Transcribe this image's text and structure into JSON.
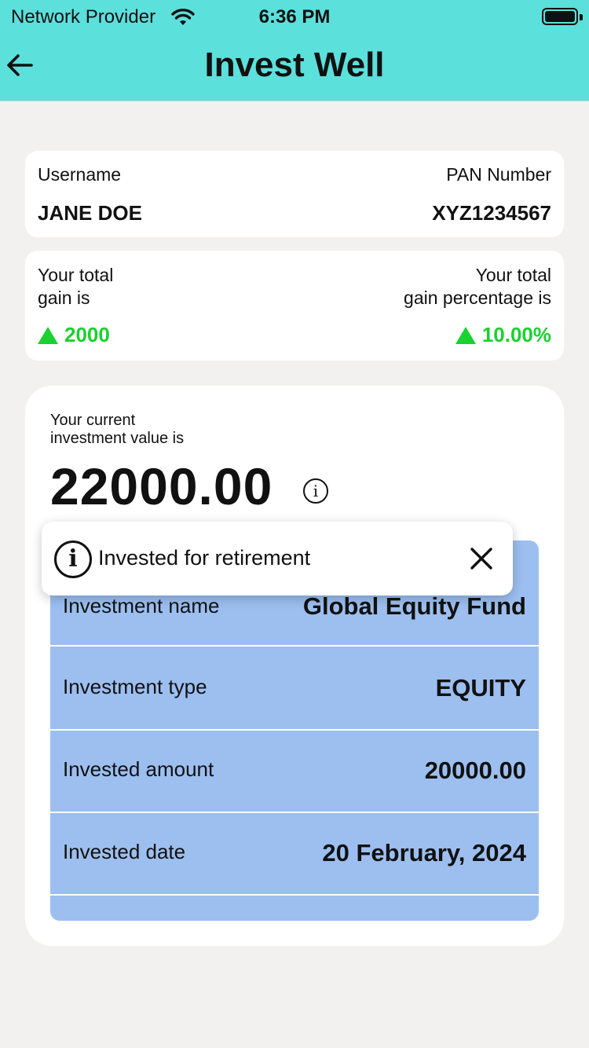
{
  "status_bar": {
    "carrier": "Network Provider",
    "time": "6:36 PM"
  },
  "header": {
    "title": "Invest Well"
  },
  "user": {
    "username_label": "Username",
    "username": "JANE DOE",
    "pan_label": "PAN Number",
    "pan": "XYZ1234567"
  },
  "gains": {
    "total_label_line1": "Your total",
    "total_label_line2": "gain is",
    "total_value": "2000",
    "pct_label_line1": "Your total",
    "pct_label_line2": "gain percentage is",
    "pct_value": "10.00%",
    "positive_color": "#19d12f"
  },
  "investment": {
    "current_label_line1": "Your current",
    "current_label_line2": "investment value is",
    "current_value": "22000.00",
    "info_glyph": "i",
    "rows": [
      {
        "key": "Investment name",
        "value": "Global Equity Fund"
      },
      {
        "key": "Investment type",
        "value": "EQUITY"
      },
      {
        "key": "Invested amount",
        "value": "20000.00"
      },
      {
        "key": "Invested date",
        "value": "20 February, 2024"
      }
    ]
  },
  "tooltip": {
    "text": "Invested for retirement",
    "icon": "info-icon"
  },
  "colors": {
    "header": "#5ce0dc",
    "table": "#9cbff0",
    "background": "#f2f1ef"
  }
}
